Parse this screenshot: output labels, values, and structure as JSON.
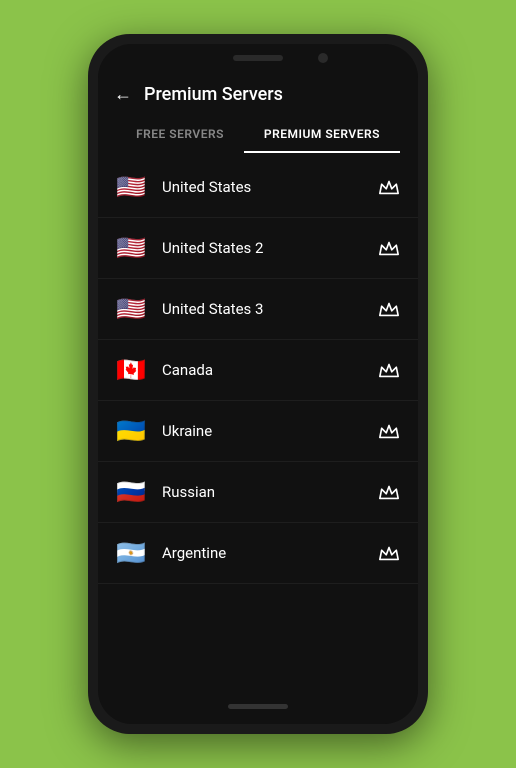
{
  "header": {
    "back_label": "←",
    "title": "Premium Servers"
  },
  "tabs": [
    {
      "id": "free",
      "label": "FREE SERVERS",
      "active": false
    },
    {
      "id": "premium",
      "label": "PREMIUM SERVERS",
      "active": true
    }
  ],
  "servers": [
    {
      "id": 1,
      "flag": "🇺🇸",
      "name": "United States"
    },
    {
      "id": 2,
      "flag": "🇺🇸",
      "name": "United States 2"
    },
    {
      "id": 3,
      "flag": "🇺🇸",
      "name": "United States 3"
    },
    {
      "id": 4,
      "flag": "🇨🇦",
      "name": "Canada"
    },
    {
      "id": 5,
      "flag": "🇺🇦",
      "name": "Ukraine"
    },
    {
      "id": 6,
      "flag": "🇷🇺",
      "name": "Russian"
    },
    {
      "id": 7,
      "flag": "🇦🇷",
      "name": "Argentine"
    }
  ]
}
